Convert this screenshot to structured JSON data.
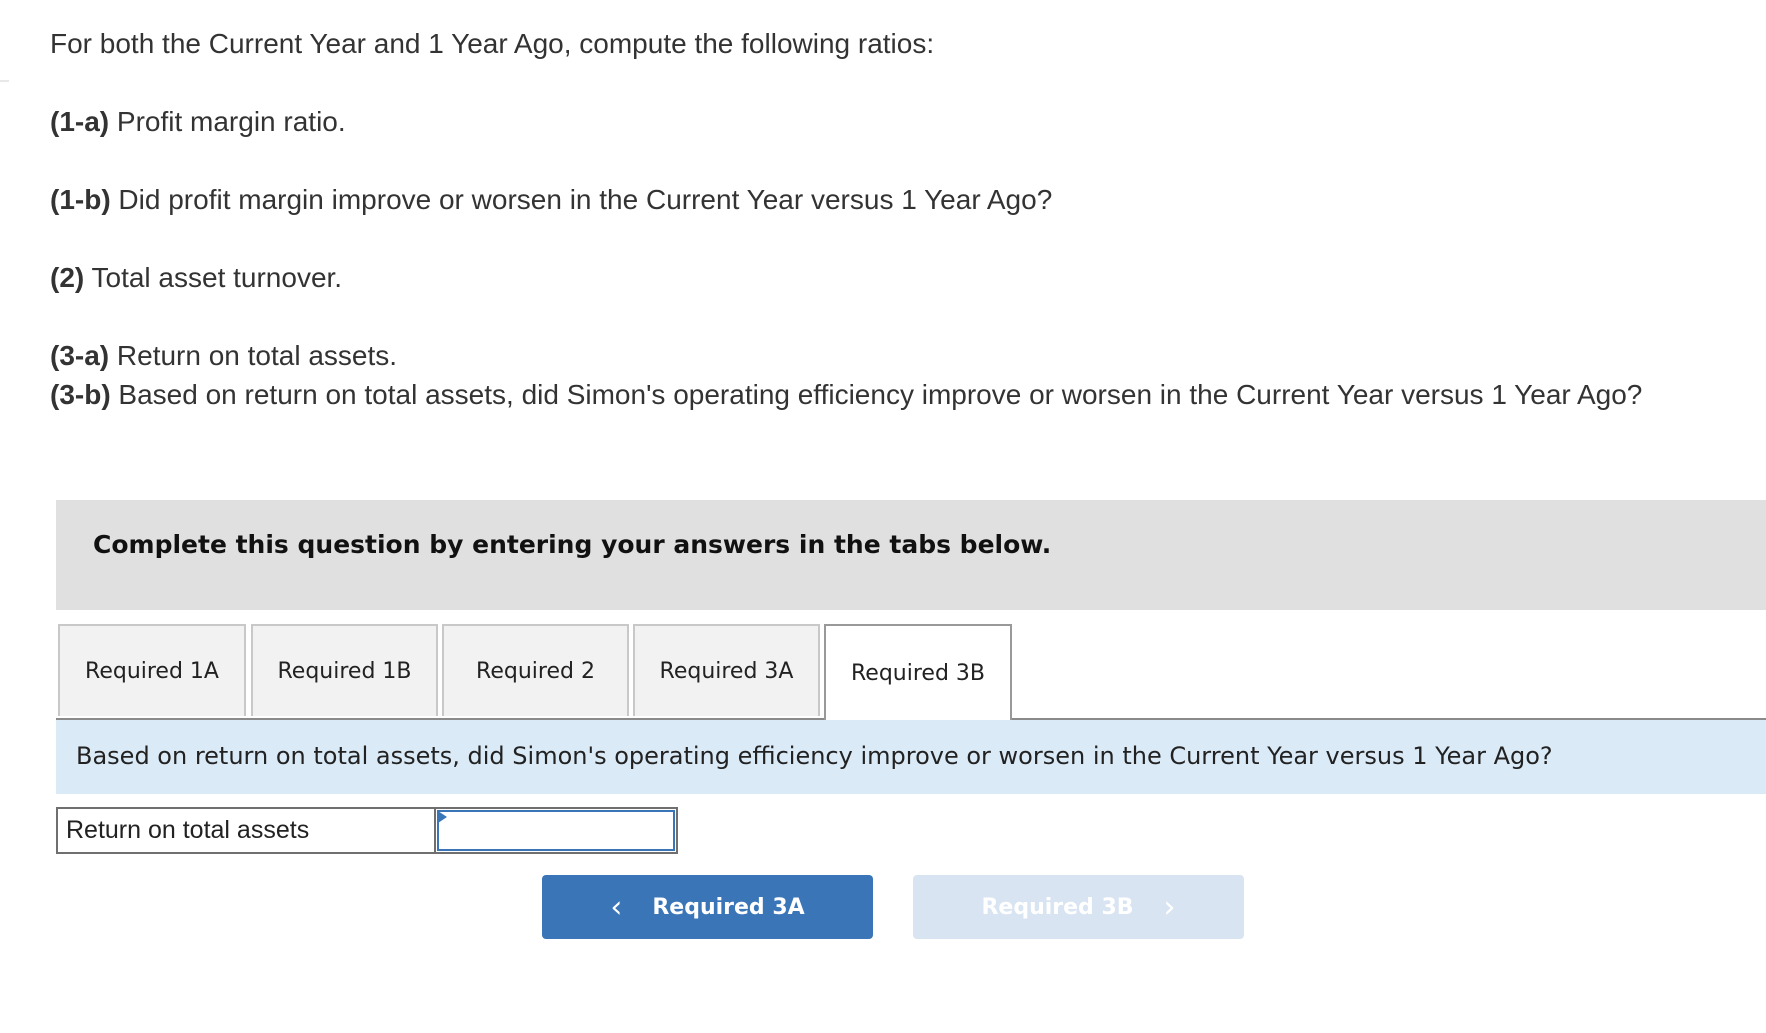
{
  "question": {
    "intro": "For both the Current Year and 1 Year Ago, compute the following ratios:",
    "parts": [
      {
        "label": "(1-a)",
        "text": " Profit margin ratio."
      },
      {
        "label": "(1-b)",
        "text": " Did profit margin improve or worsen in the Current Year versus 1 Year Ago?"
      },
      {
        "label": "(2)",
        "text": " Total asset turnover."
      },
      {
        "label": "(3-a)",
        "text": " Return on total assets."
      },
      {
        "label": "(3-b)",
        "text": " Based on return on total assets, did Simon's operating efficiency improve or worsen in the Current Year versus 1 Year Ago?"
      }
    ]
  },
  "instructions": "Complete this question by entering your answers in the tabs below.",
  "tabs": [
    {
      "label": "Required 1A",
      "active": false
    },
    {
      "label": "Required 1B",
      "active": false
    },
    {
      "label": "Required 2",
      "active": false
    },
    {
      "label": "Required 3A",
      "active": false
    },
    {
      "label": "Required 3B",
      "active": true
    }
  ],
  "tab_question": "Based on return on total assets, did Simon's operating efficiency improve or worsen in the Current Year versus 1 Year Ago?",
  "answer_row": {
    "label": "Return on total assets",
    "selected_value": ""
  },
  "nav": {
    "prev_label": "Required 3A",
    "next_label": "Required 3B",
    "prev_icon": "chevron-left-icon",
    "next_icon": "chevron-right-icon",
    "prev_chevron": "‹",
    "next_chevron": "›"
  },
  "colors": {
    "accent": "#3a75b8",
    "disabled": "#d8e4f1",
    "instructions_bg": "#e0e0e0",
    "question_bar_bg": "#daeaf7"
  }
}
